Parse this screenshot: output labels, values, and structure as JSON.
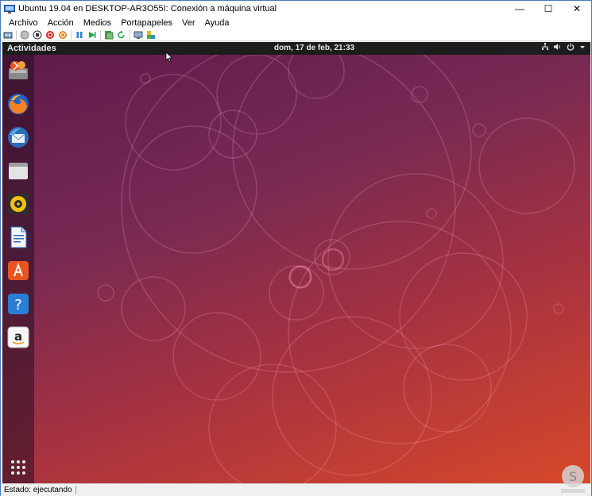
{
  "window": {
    "title": "Ubuntu 19.04 en DESKTOP-AR3O55I: Conexión a máquina virtual",
    "minimize": "—",
    "maximize": "☐",
    "close": "✕"
  },
  "menubar": {
    "items": [
      "Archivo",
      "Acción",
      "Medios",
      "Portapapeles",
      "Ver",
      "Ayuda"
    ]
  },
  "toolbar": {
    "icons": [
      "ctrl-alt-del-icon",
      "start-icon",
      "turn-off-icon",
      "shutdown-icon",
      "save-icon",
      "pause-icon",
      "reset-icon",
      "checkpoint-icon",
      "revert-icon",
      "enhanced-session-icon",
      "share-icon"
    ]
  },
  "ubuntu": {
    "activities": "Actividades",
    "clock": "dom, 17 de feb, 21:33",
    "dock": [
      "software-updater-icon",
      "firefox-icon",
      "thunderbird-icon",
      "files-icon",
      "rhythmbox-icon",
      "libreoffice-writer-icon",
      "ubuntu-software-icon",
      "help-icon",
      "amazon-icon"
    ],
    "show_apps": "show-applications-icon",
    "tray": [
      "network-icon",
      "volume-icon",
      "power-icon",
      "chevron-down-icon"
    ]
  },
  "statusbar": {
    "status": "Estado: ejecutando"
  },
  "colors": {
    "accent": "#e95420",
    "aubergine": "#772953",
    "topbar": "#1d1d1d"
  }
}
